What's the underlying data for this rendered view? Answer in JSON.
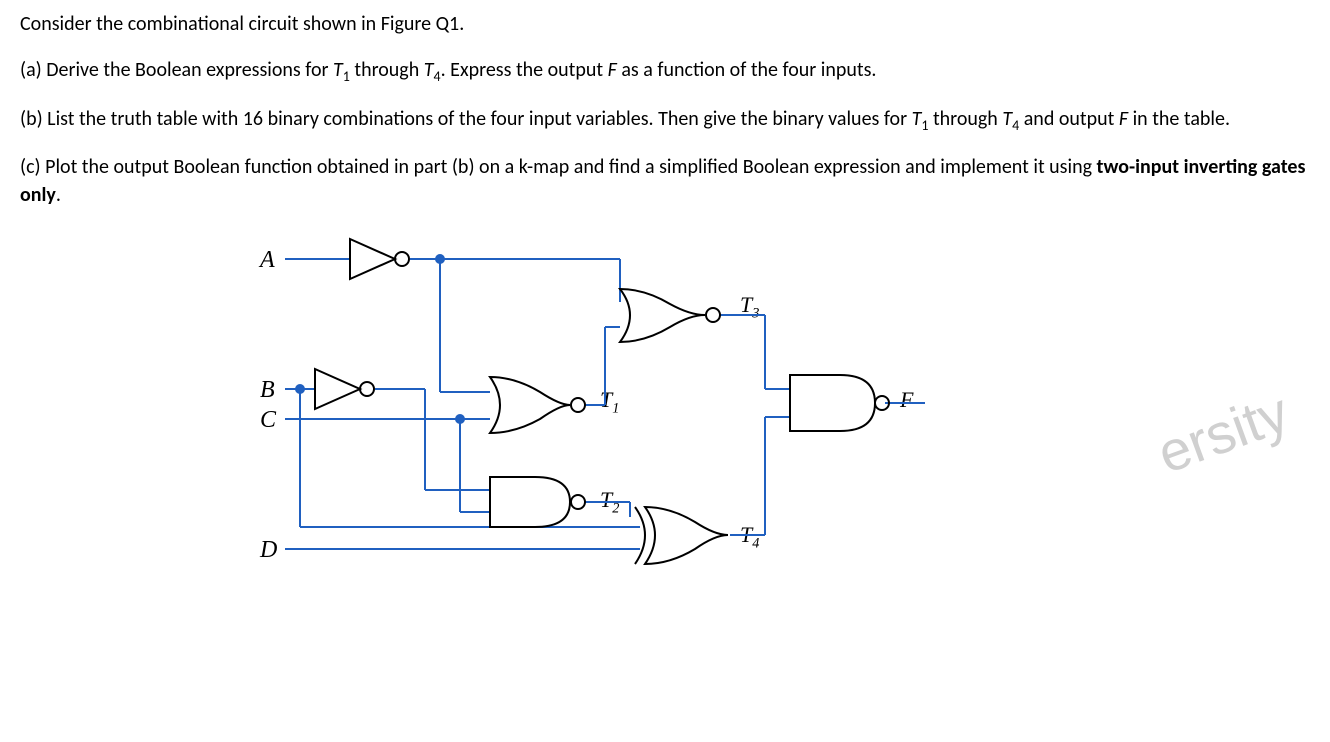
{
  "text": {
    "intro": "Consider the combinational circuit shown in Figure Q1.",
    "partA": "(a) Derive the Boolean expressions for ",
    "partA_t1": "T",
    "partA_sub1": "1",
    "partA_mid": " through ",
    "partA_t4": "T",
    "partA_sub4": "4",
    "partA_end": ". Express the output ",
    "partA_F": "F",
    "partA_final": " as a function of the four inputs.",
    "partB": "(b) List the truth table with 16 binary combinations of the four input variables. Then give the binary values for ",
    "partB_t1": "T",
    "partB_sub1": "1",
    "partB_mid": " through ",
    "partB_t4": "T",
    "partB_sub4": "4",
    "partB_and": " and output ",
    "partB_F": "F",
    "partB_end": " in the table.",
    "partC": "(c) Plot the output Boolean function obtained in part (b) on a k-map and find a simplified Boolean expression and implement it using ",
    "partC_bold": "two-input inverting gates only",
    "partC_end": "."
  },
  "circuit": {
    "inputs": {
      "A": "A",
      "B": "B",
      "C": "C",
      "D": "D"
    },
    "signals": {
      "T1": "T",
      "T1_sub": "1",
      "T2": "T",
      "T2_sub": "2",
      "T3": "T",
      "T3_sub": "3",
      "T4": "T",
      "T4_sub": "4",
      "F": "F"
    }
  },
  "watermark": "ersity"
}
